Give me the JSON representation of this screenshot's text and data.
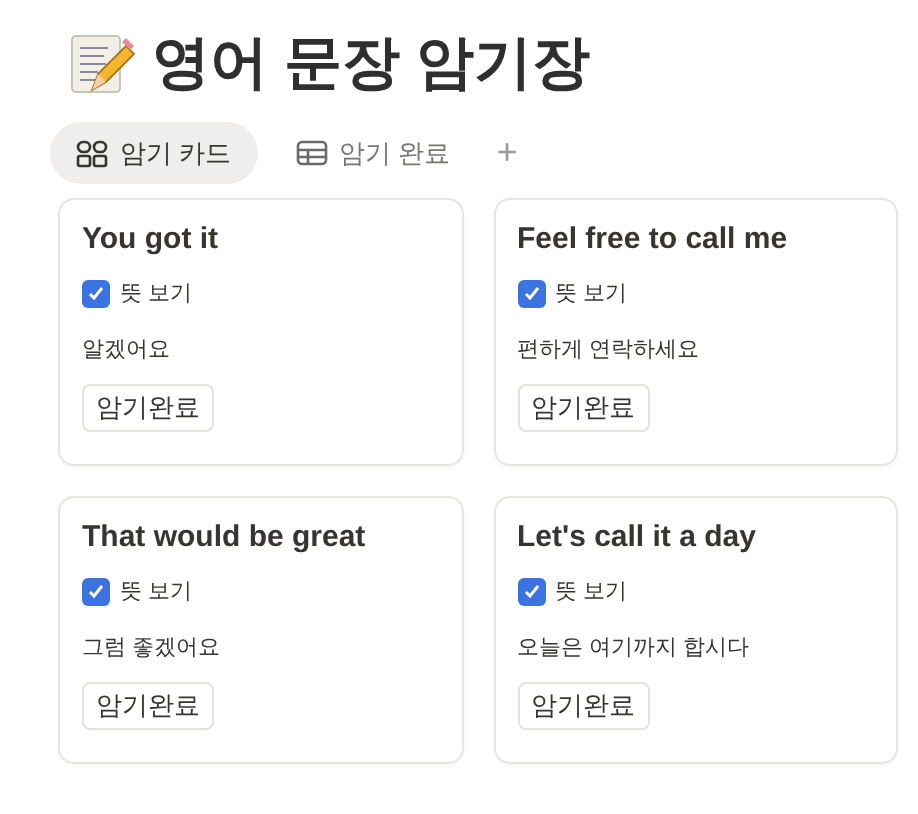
{
  "page": {
    "title": "영어 문장 암기장"
  },
  "tabs": [
    {
      "label": "암기 카드",
      "selected": true,
      "kind": "gallery"
    },
    {
      "label": "암기 완료",
      "selected": false,
      "kind": "table"
    }
  ],
  "add_tab": "+",
  "cards": [
    {
      "title": "You got it",
      "toggle": {
        "label": "뜻 보기",
        "checked": true
      },
      "meaning": "알겠어요",
      "button": "암기완료"
    },
    {
      "title": "Feel free to call me",
      "toggle": {
        "label": "뜻 보기",
        "checked": true
      },
      "meaning": "편하게 연락하세요",
      "button": "암기완료"
    },
    {
      "title": "That would be great",
      "toggle": {
        "label": "뜻 보기",
        "checked": true
      },
      "meaning": "그럼 좋겠어요",
      "button": "암기완료"
    },
    {
      "title": "Let's call it a day",
      "toggle": {
        "label": "뜻 보기",
        "checked": true
      },
      "meaning": "오늘은 여기까지 합시다",
      "button": "암기완료"
    }
  ]
}
